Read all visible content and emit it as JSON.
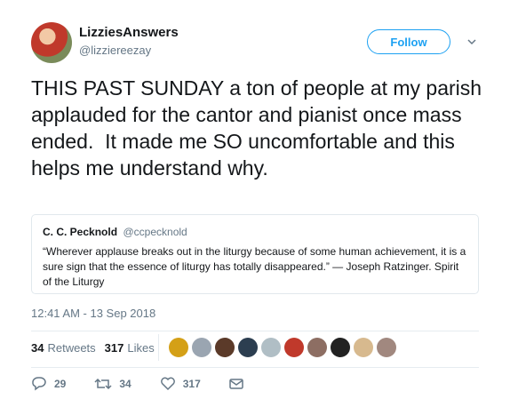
{
  "author": {
    "display_name": "LizziesAnswers",
    "handle": "@lizziereezay"
  },
  "follow_button": {
    "label": "Follow"
  },
  "tweet": {
    "text": "THIS PAST SUNDAY a ton of people at my parish applauded for the cantor and pianist once mass ended.  It made me SO uncomfortable and this helps me understand why.",
    "timestamp": "12:41 AM - 13 Sep 2018"
  },
  "quote": {
    "name": "C. C. Pecknold",
    "handle": "@ccpecknold",
    "text": "“Wherever applause breaks out in the liturgy because of some human achievement, it is a sure sign that the essence of liturgy has totally disappeared.” — Joseph Ratzinger. Spirit of the Liturgy"
  },
  "stats": {
    "retweets_count": "34",
    "retweets_label": "Retweets",
    "likes_count": "317",
    "likes_label": "Likes"
  },
  "likers": [
    {
      "icon": "liker-avatar",
      "color": "#d4a017"
    },
    {
      "icon": "liker-avatar",
      "color": "#9aa5b1"
    },
    {
      "icon": "liker-avatar",
      "color": "#5b3a29"
    },
    {
      "icon": "liker-avatar",
      "color": "#2c3e50"
    },
    {
      "icon": "liker-avatar",
      "color": "#b0bec5"
    },
    {
      "icon": "liker-avatar",
      "color": "#c0392b"
    },
    {
      "icon": "liker-avatar",
      "color": "#8d6e63"
    },
    {
      "icon": "liker-avatar",
      "color": "#222222"
    },
    {
      "icon": "liker-avatar",
      "color": "#d7b98e"
    },
    {
      "icon": "liker-avatar",
      "color": "#a1887f"
    }
  ],
  "actions": {
    "replies": "29",
    "retweets": "34",
    "likes": "317"
  },
  "colors": {
    "accent": "#1da1f2",
    "secondary_text": "#657786",
    "border": "#e1e8ed"
  }
}
